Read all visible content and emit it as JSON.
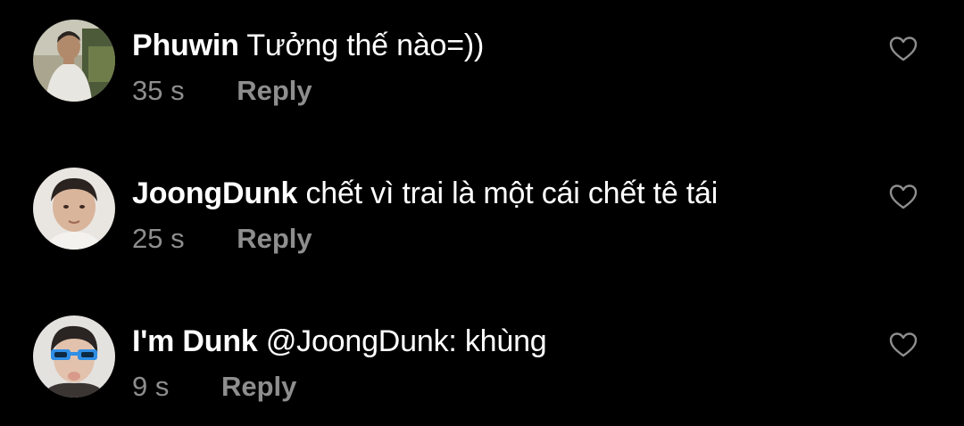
{
  "colors": {
    "background": "#000000",
    "text": "#ffffff",
    "muted": "#8e8e8e"
  },
  "comments": [
    {
      "username": "Phuwin",
      "message": "Tưởng thế nào=))",
      "time": "35 s",
      "reply_label": "Reply",
      "icon": "heart-outline-icon"
    },
    {
      "username": "JoongDunk",
      "message": "chết vì trai là một cái chết tê tái",
      "time": "25 s",
      "reply_label": "Reply",
      "icon": "heart-outline-icon"
    },
    {
      "username": "I'm Dunk",
      "message": "@JoongDunk: khùng",
      "time": "9 s",
      "reply_label": "Reply",
      "icon": "heart-outline-icon"
    }
  ]
}
